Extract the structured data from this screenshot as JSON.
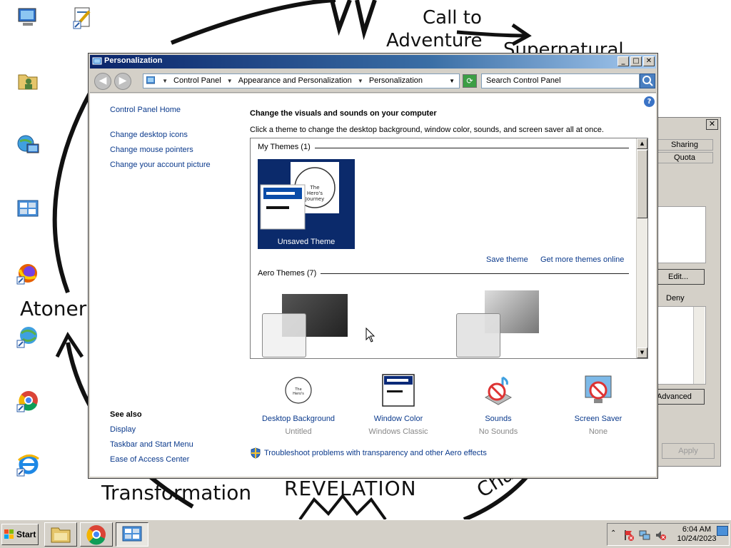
{
  "wallpaper": {
    "labels": {
      "call": "Call to",
      "adventure": "Adventure",
      "supernatural": "Supernatural",
      "atonement": "Atoner",
      "transformation": "Transformation",
      "revelation": "REVELATION",
      "challenge": "Challe"
    }
  },
  "desktop_icons": [
    "computer-icon",
    "document-shortcut-icon",
    "user-folder-icon",
    "network-icon",
    "control-panel-icon",
    "firefox-icon",
    "internet-shortcut-icon",
    "chrome-icon",
    "ie-icon"
  ],
  "window": {
    "title": "Personalization",
    "controls": {
      "minimize": "_",
      "maximize": "□",
      "close": "✕"
    },
    "address": {
      "crumbs": [
        "Control Panel",
        "Appearance and Personalization",
        "Personalization"
      ]
    },
    "search": {
      "placeholder": "Search Control Panel"
    }
  },
  "sidebar": {
    "home": "Control Panel Home",
    "links": [
      "Change desktop icons",
      "Change mouse pointers",
      "Change your account picture"
    ],
    "see_also_title": "See also",
    "see_also": [
      "Display",
      "Taskbar and Start Menu",
      "Ease of Access Center"
    ]
  },
  "main": {
    "heading": "Change the visuals and sounds on your computer",
    "subtext": "Click a theme to change the desktop background, window color, sounds, and screen saver all at once.",
    "my_themes_title": "My Themes (1)",
    "unsaved_theme": "Unsaved Theme",
    "save_theme": "Save theme",
    "get_more": "Get more themes online",
    "aero_title": "Aero Themes (7)",
    "bottom_items": [
      {
        "label": "Desktop Background",
        "value": "Untitled",
        "icon": "desktop-background-icon"
      },
      {
        "label": "Window Color",
        "value": "Windows Classic",
        "icon": "window-color-icon"
      },
      {
        "label": "Sounds",
        "value": "No Sounds",
        "icon": "sounds-icon"
      },
      {
        "label": "Screen Saver",
        "value": "None",
        "icon": "screen-saver-icon"
      }
    ],
    "troubleshoot": "Troubleshoot problems with transparency and other Aero effects"
  },
  "background_dialog": {
    "tabs": [
      "Sharing",
      "Quota"
    ],
    "edit_button": "Edit...",
    "deny_label": "Deny",
    "advanced_button": "Advanced",
    "apply_button": "Apply",
    "close": "✕"
  },
  "taskbar": {
    "start": "Start",
    "apps": [
      "explorer-icon",
      "chrome-icon",
      "control-panel-icon"
    ],
    "clock": {
      "time": "6:04 AM",
      "date": "10/24/2023"
    }
  }
}
